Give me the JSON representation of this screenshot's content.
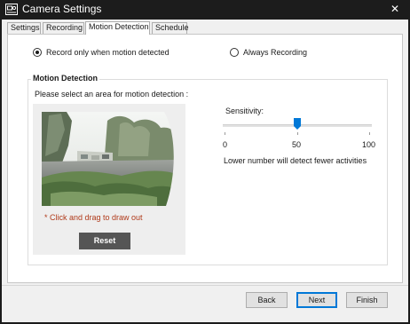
{
  "window": {
    "title": "Camera Settings",
    "close_glyph": "✕"
  },
  "tabs": [
    {
      "label": "Settings",
      "active": false
    },
    {
      "label": "Recording",
      "active": false
    },
    {
      "label": "Motion Detection",
      "active": true
    },
    {
      "label": "Schedule",
      "active": false
    }
  ],
  "recording_mode": {
    "options": [
      {
        "label": "Record only when motion detected",
        "selected": true
      },
      {
        "label": "Always Recording",
        "selected": false
      }
    ]
  },
  "motion_detection": {
    "group_title": "Motion Detection",
    "select_area_label": "Please select an area for motion detection :",
    "hint": "* Click and drag to draw out",
    "reset_label": "Reset"
  },
  "sensitivity": {
    "label": "Sensitivity:",
    "min": 0,
    "mid": 50,
    "max": 100,
    "value": 50,
    "min_label": "0",
    "mid_label": "50",
    "max_label": "100",
    "note": "Lower number will detect fewer activities"
  },
  "footer": {
    "back_label": "Back",
    "next_label": "Next",
    "finish_label": "Finish"
  },
  "colors": {
    "title_bar": "#1c1c1c",
    "accent": "#0078d7",
    "hint_text": "#b03a1a",
    "reset_button": "#555555"
  },
  "icons": {
    "app": "camera-settings-icon",
    "close": "close-icon",
    "slider_thumb": "slider-thumb-icon"
  }
}
